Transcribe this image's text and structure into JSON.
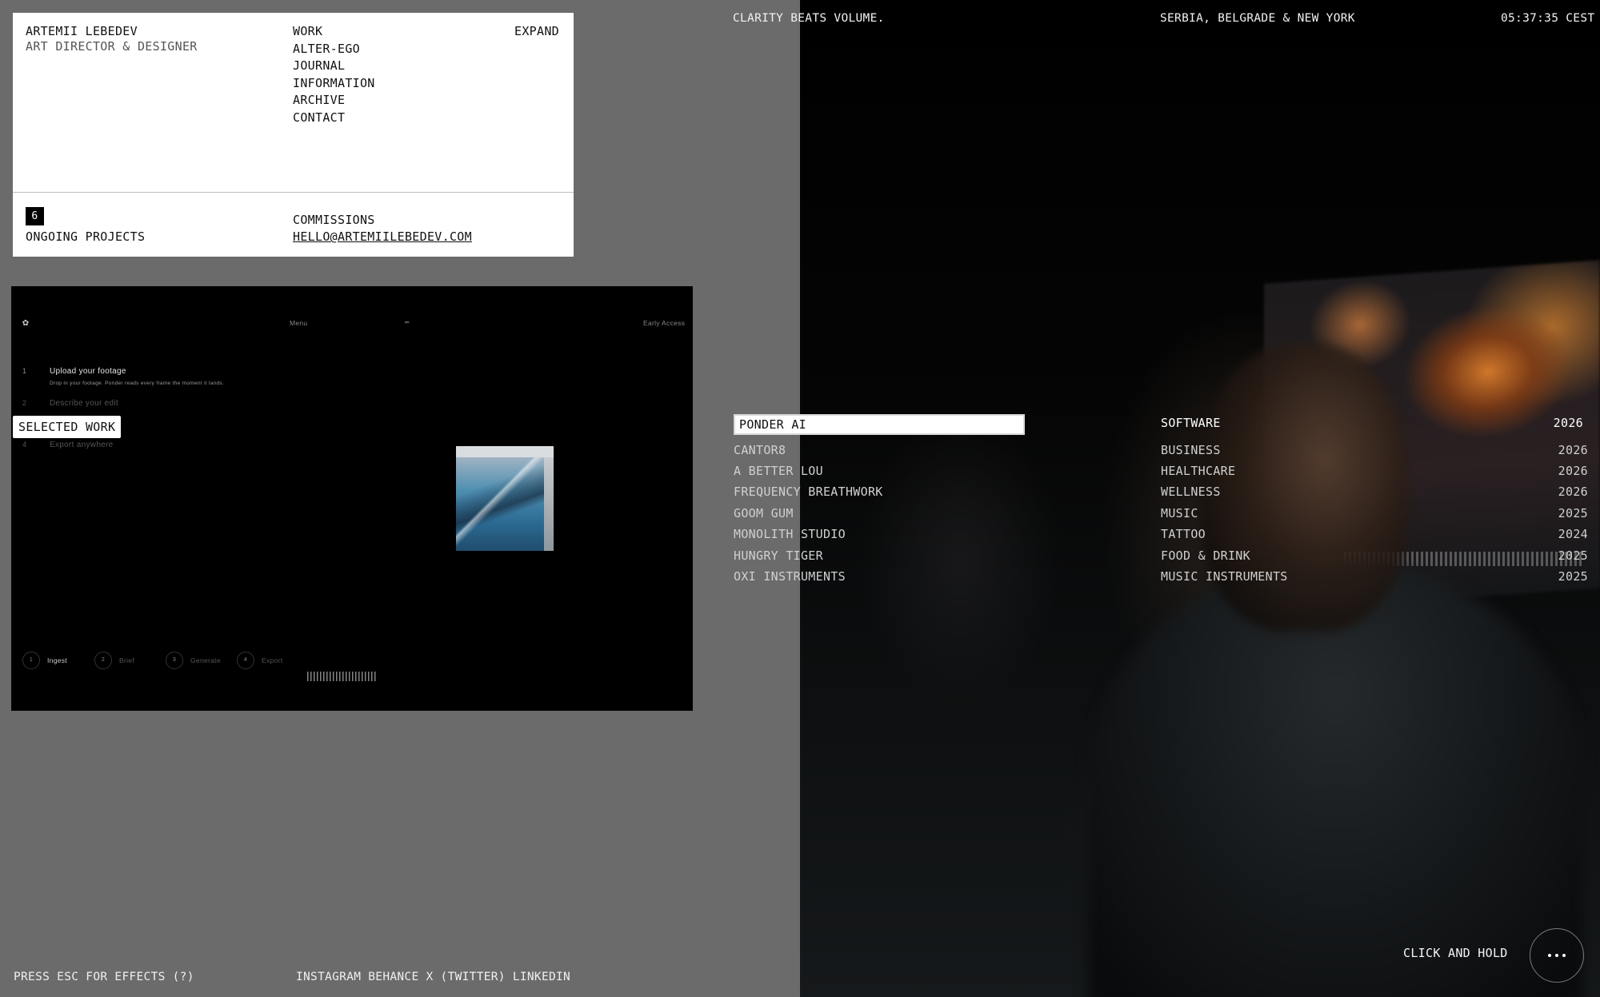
{
  "topbar": {
    "tagline": "CLARITY BEATS VOLUME.",
    "location": "SERBIA, BELGRADE & NEW YORK",
    "time": "05:37:35 CEST"
  },
  "card": {
    "name": "ARTEMII LEBEDEV",
    "role": "ART DIRECTOR & DESIGNER",
    "expand_label": "EXPAND",
    "nav": [
      "WORK",
      "ALTER-EGO",
      "JOURNAL",
      "INFORMATION",
      "ARCHIVE",
      "CONTACT"
    ],
    "projects_count": "6",
    "projects_label": "ONGOING PROJECTS",
    "commissions_label": "COMMISSIONS",
    "email": "HELLO@ARTEMIILEBEDEV.COM"
  },
  "preview": {
    "menu_label": "Menu",
    "early_access": "Early Access",
    "steps": [
      {
        "num": "1",
        "title": "Upload your footage",
        "desc": "Drop in your footage. Ponder reads every frame the moment it lands."
      },
      {
        "num": "2",
        "title": "Describe your edit"
      },
      {
        "num": "4",
        "title": "Export anywhere"
      }
    ],
    "pills": [
      {
        "num": "1",
        "label": "Ingest"
      },
      {
        "num": "2",
        "label": "Brief"
      },
      {
        "num": "3",
        "label": "Generate"
      },
      {
        "num": "4",
        "label": "Export"
      }
    ]
  },
  "selected_work_label": "SELECTED WORK",
  "projects": [
    {
      "name": "PONDER AI",
      "category": "SOFTWARE",
      "year": "2026"
    },
    {
      "name": "CANTOR8",
      "category": "BUSINESS",
      "year": "2026"
    },
    {
      "name": "A BETTER LOU",
      "category": "HEALTHCARE",
      "year": "2026"
    },
    {
      "name": "FREQUENCY BREATHWORK",
      "category": "WELLNESS",
      "year": "2026"
    },
    {
      "name": "GOOM GUM",
      "category": "MUSIC",
      "year": "2025"
    },
    {
      "name": "MONOLITH STUDIO",
      "category": "TATTOO",
      "year": "2024"
    },
    {
      "name": "HUNGRY TIGER",
      "category": "FOOD & DRINK",
      "year": "2025"
    },
    {
      "name": "OXI INSTRUMENTS",
      "category": "MUSIC INSTRUMENTS",
      "year": "2025"
    }
  ],
  "footer": {
    "esc_hint": "PRESS ESC FOR EFFECTS (?)",
    "socials": [
      "INSTAGRAM",
      "BEHANCE",
      "X (TWITTER)",
      "LINKEDIN"
    ],
    "click_hold": "CLICK AND HOLD"
  }
}
